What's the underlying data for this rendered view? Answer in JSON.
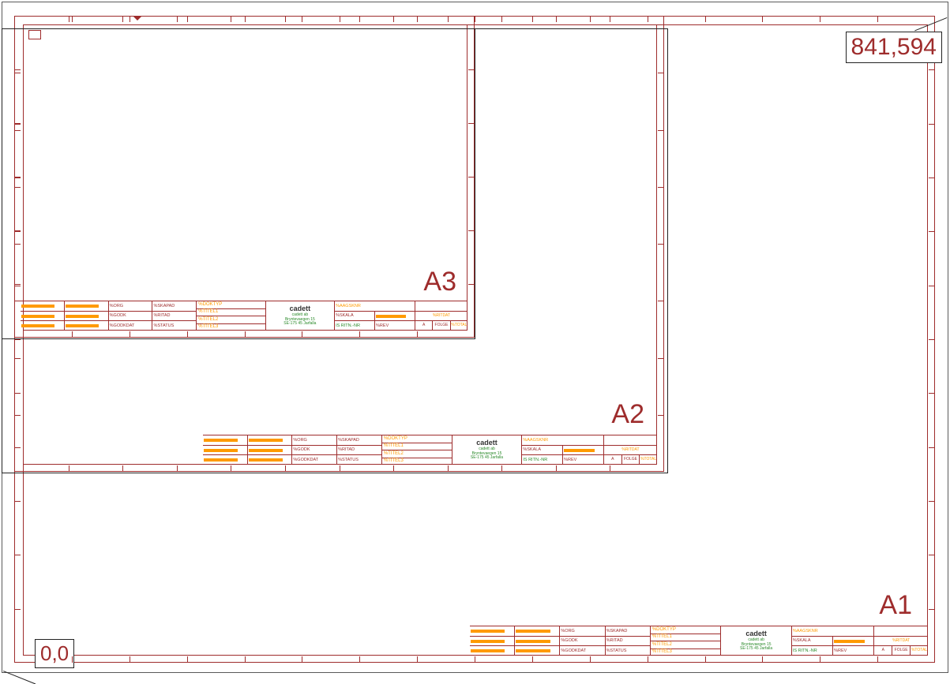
{
  "diagram": {
    "coord_origin": "0,0",
    "coord_extent": "841,594",
    "sheets": [
      {
        "id": "A1",
        "label": "A1",
        "titleblock": {
          "doktyp": "%DOKTYP",
          "titel1": "%TITEL1",
          "titel2": "%TITEL2",
          "titel3": "%TITEL3",
          "logo": "cadett",
          "company1": "cadett ab",
          "company2": "Bryntevaegen 15",
          "company3": "SE-175 45 Jarfalla",
          "iaagsknr": "%AAGSKNR",
          "iorg": "%ORG",
          "igodk": "%GODK",
          "igodkdat": "%GODKDAT",
          "iskala": "%SKALA",
          "iskapad": "%SKAPAD",
          "istatus": "%STATUS",
          "iritad": "%RITAD",
          "irev": "%REV",
          "iritdat": "%RITDAT",
          "a": "A",
          "folge": "FOLGE",
          "itotal": "%TOTAL",
          "is_ritn_nr": "IS RITN.-NR"
        }
      },
      {
        "id": "A2",
        "label": "A2",
        "titleblock": {
          "doktyp": "%DOKTYP",
          "titel1": "%TITEL1",
          "titel2": "%TITEL2",
          "titel3": "%TITEL3",
          "logo": "cadett",
          "company1": "cadett ab",
          "company2": "Bryntevaegen 15",
          "company3": "SE-175 45 Jarfalla",
          "iaagsknr": "%AAGSKNR",
          "iorg": "%ORG",
          "igodk": "%GODK",
          "igodkdat": "%GODKDAT",
          "iskala": "%SKALA",
          "iskapad": "%SKAPAD",
          "istatus": "%STATUS",
          "iritad": "%RITAD",
          "irev": "%REV",
          "iritdat": "%RITDAT",
          "a": "A",
          "folge": "FOLGE",
          "itotal": "%TOTAL",
          "is_ritn_nr": "IS RITN.-NR"
        }
      },
      {
        "id": "A3",
        "label": "A3",
        "titleblock": {
          "doktyp": "%DOKTYP",
          "titel1": "%TITEL1",
          "titel2": "%TITEL2",
          "titel3": "%TITEL3",
          "logo": "cadett",
          "company1": "cadett ab",
          "company2": "Bryntevaegen 15",
          "company3": "SE-175 45 Jarfalla",
          "iaagsknr": "%AAGSKNR",
          "iorg": "%ORG",
          "igodk": "%GODK",
          "igodkdat": "%GODKDAT",
          "iskala": "%SKALA",
          "iskapad": "%SKAPAD",
          "istatus": "%STATUS",
          "iritad": "%RITAD",
          "irev": "%REV",
          "iritdat": "%RITDAT",
          "a": "A",
          "folge": "FOLGE",
          "itotal": "%TOTAL",
          "is_ritn_nr": "IS RITN.-NR"
        }
      }
    ]
  }
}
